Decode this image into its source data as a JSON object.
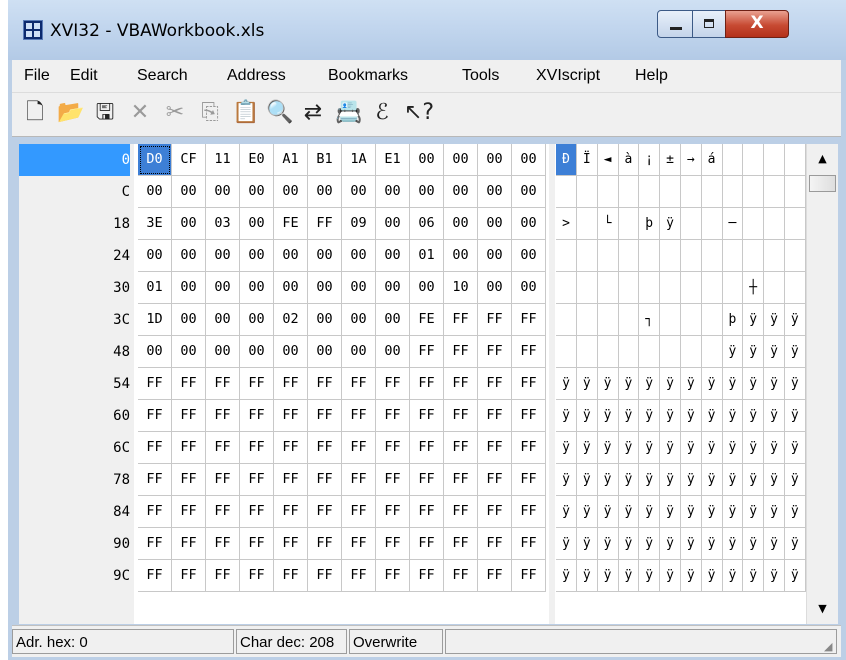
{
  "window": {
    "title": "XVI32 - VBAWorkbook.xls",
    "close_glyph": "X"
  },
  "menubar": {
    "items": [
      "File",
      "Edit",
      "Search",
      "Address",
      "Bookmarks",
      "Tools",
      "XVIscript",
      "Help"
    ]
  },
  "toolbar": {
    "buttons": [
      {
        "name": "new-file-icon",
        "glyph": "🗋",
        "enabled": true
      },
      {
        "name": "open-folder-icon",
        "glyph": "📂",
        "enabled": true
      },
      {
        "name": "save-disk-icon",
        "glyph": "🖫",
        "enabled": true
      },
      {
        "name": "delete-x-icon",
        "glyph": "✕",
        "enabled": false
      },
      {
        "name": "cut-scissors-icon",
        "glyph": "✂",
        "enabled": false
      },
      {
        "name": "copy-icon",
        "glyph": "⎘",
        "enabled": false
      },
      {
        "name": "paste-clipboard-icon",
        "glyph": "📋",
        "enabled": true
      },
      {
        "name": "find-magnifier-icon",
        "glyph": "🔍",
        "enabled": true
      },
      {
        "name": "replace-icon",
        "glyph": "⇄",
        "enabled": true
      },
      {
        "name": "properties-icon",
        "glyph": "📇",
        "enabled": true
      },
      {
        "name": "script-icon",
        "glyph": "ℰ",
        "enabled": true
      },
      {
        "name": "context-help-icon",
        "glyph": "↖?",
        "enabled": true
      }
    ]
  },
  "editor": {
    "addresses": [
      "0",
      "C",
      "18",
      "24",
      "30",
      "3C",
      "48",
      "54",
      "60",
      "6C",
      "78",
      "84",
      "90",
      "9C"
    ],
    "selected_address": "0",
    "hex_rows": [
      [
        "D0",
        "CF",
        "11",
        "E0",
        "A1",
        "B1",
        "1A",
        "E1",
        "00",
        "00",
        "00",
        "00"
      ],
      [
        "00",
        "00",
        "00",
        "00",
        "00",
        "00",
        "00",
        "00",
        "00",
        "00",
        "00",
        "00"
      ],
      [
        "3E",
        "00",
        "03",
        "00",
        "FE",
        "FF",
        "09",
        "00",
        "06",
        "00",
        "00",
        "00"
      ],
      [
        "00",
        "00",
        "00",
        "00",
        "00",
        "00",
        "00",
        "00",
        "01",
        "00",
        "00",
        "00"
      ],
      [
        "01",
        "00",
        "00",
        "00",
        "00",
        "00",
        "00",
        "00",
        "00",
        "10",
        "00",
        "00"
      ],
      [
        "1D",
        "00",
        "00",
        "00",
        "02",
        "00",
        "00",
        "00",
        "FE",
        "FF",
        "FF",
        "FF"
      ],
      [
        "00",
        "00",
        "00",
        "00",
        "00",
        "00",
        "00",
        "00",
        "FF",
        "FF",
        "FF",
        "FF"
      ],
      [
        "FF",
        "FF",
        "FF",
        "FF",
        "FF",
        "FF",
        "FF",
        "FF",
        "FF",
        "FF",
        "FF",
        "FF"
      ],
      [
        "FF",
        "FF",
        "FF",
        "FF",
        "FF",
        "FF",
        "FF",
        "FF",
        "FF",
        "FF",
        "FF",
        "FF"
      ],
      [
        "FF",
        "FF",
        "FF",
        "FF",
        "FF",
        "FF",
        "FF",
        "FF",
        "FF",
        "FF",
        "FF",
        "FF"
      ],
      [
        "FF",
        "FF",
        "FF",
        "FF",
        "FF",
        "FF",
        "FF",
        "FF",
        "FF",
        "FF",
        "FF",
        "FF"
      ],
      [
        "FF",
        "FF",
        "FF",
        "FF",
        "FF",
        "FF",
        "FF",
        "FF",
        "FF",
        "FF",
        "FF",
        "FF"
      ],
      [
        "FF",
        "FF",
        "FF",
        "FF",
        "FF",
        "FF",
        "FF",
        "FF",
        "FF",
        "FF",
        "FF",
        "FF"
      ],
      [
        "FF",
        "FF",
        "FF",
        "FF",
        "FF",
        "FF",
        "FF",
        "FF",
        "FF",
        "FF",
        "FF",
        "FF"
      ]
    ],
    "char_rows": [
      [
        "Ð",
        "Ï",
        "◄",
        "à",
        "¡",
        "±",
        "→",
        "á",
        "",
        "",
        "",
        ""
      ],
      [
        "",
        "",
        "",
        "",
        "",
        "",
        "",
        "",
        "",
        "",
        "",
        ""
      ],
      [
        ">",
        "",
        "└",
        "",
        "þ",
        "ÿ",
        "",
        "",
        "─",
        "",
        "",
        ""
      ],
      [
        "",
        "",
        "",
        "",
        "",
        "",
        "",
        "",
        "",
        "",
        "",
        ""
      ],
      [
        "",
        "",
        "",
        "",
        "",
        "",
        "",
        "",
        "",
        "┼",
        "",
        ""
      ],
      [
        "",
        "",
        "",
        "",
        "┐",
        "",
        "",
        "",
        "þ",
        "ÿ",
        "ÿ",
        "ÿ"
      ],
      [
        "",
        "",
        "",
        "",
        "",
        "",
        "",
        "",
        "ÿ",
        "ÿ",
        "ÿ",
        "ÿ"
      ],
      [
        "ÿ",
        "ÿ",
        "ÿ",
        "ÿ",
        "ÿ",
        "ÿ",
        "ÿ",
        "ÿ",
        "ÿ",
        "ÿ",
        "ÿ",
        "ÿ"
      ],
      [
        "ÿ",
        "ÿ",
        "ÿ",
        "ÿ",
        "ÿ",
        "ÿ",
        "ÿ",
        "ÿ",
        "ÿ",
        "ÿ",
        "ÿ",
        "ÿ"
      ],
      [
        "ÿ",
        "ÿ",
        "ÿ",
        "ÿ",
        "ÿ",
        "ÿ",
        "ÿ",
        "ÿ",
        "ÿ",
        "ÿ",
        "ÿ",
        "ÿ"
      ],
      [
        "ÿ",
        "ÿ",
        "ÿ",
        "ÿ",
        "ÿ",
        "ÿ",
        "ÿ",
        "ÿ",
        "ÿ",
        "ÿ",
        "ÿ",
        "ÿ"
      ],
      [
        "ÿ",
        "ÿ",
        "ÿ",
        "ÿ",
        "ÿ",
        "ÿ",
        "ÿ",
        "ÿ",
        "ÿ",
        "ÿ",
        "ÿ",
        "ÿ"
      ],
      [
        "ÿ",
        "ÿ",
        "ÿ",
        "ÿ",
        "ÿ",
        "ÿ",
        "ÿ",
        "ÿ",
        "ÿ",
        "ÿ",
        "ÿ",
        "ÿ"
      ],
      [
        "ÿ",
        "ÿ",
        "ÿ",
        "ÿ",
        "ÿ",
        "ÿ",
        "ÿ",
        "ÿ",
        "ÿ",
        "ÿ",
        "ÿ",
        "ÿ"
      ]
    ]
  },
  "statusbar": {
    "address": "Adr. hex: 0",
    "char_dec": "Char dec: 208",
    "mode": "Overwrite"
  },
  "colors": {
    "selection": "#3399ff",
    "cursor_cell": "#3d7fd6",
    "chrome": "#f0f0f0",
    "close_button": "#c74a32"
  }
}
